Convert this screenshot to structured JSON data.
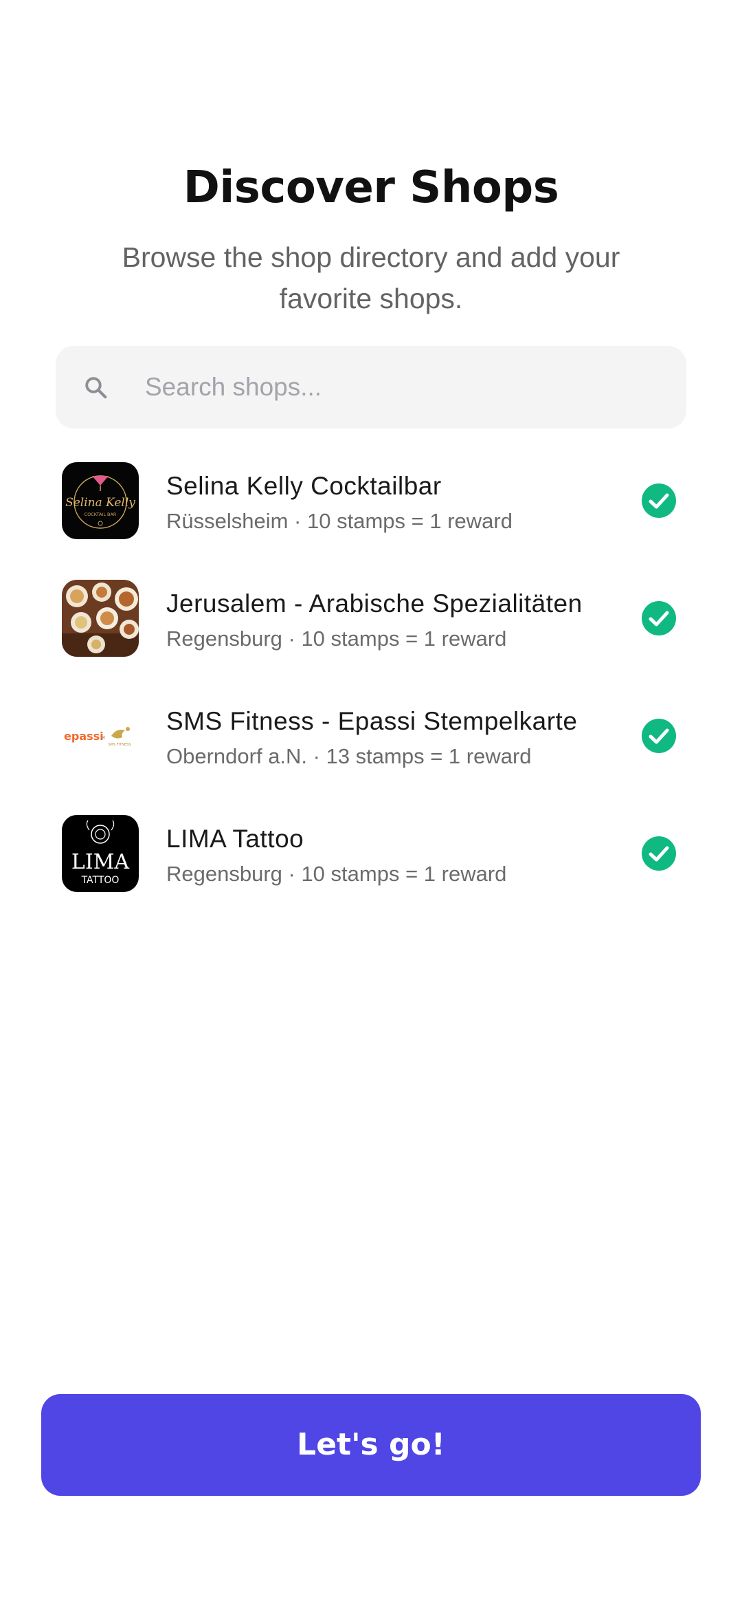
{
  "header": {
    "title": "Discover Shops",
    "subtitle": "Browse the shop directory and add your favorite shops."
  },
  "search": {
    "placeholder": "Search shops...",
    "value": "",
    "icon": "search-icon"
  },
  "shops": [
    {
      "name": "Selina Kelly Cocktailbar",
      "meta": "Rüsselsheim · 10 stamps = 1 reward",
      "logo_text": "Selina Kelly",
      "logo_subtext": "COCKTAIL BAR",
      "added": true
    },
    {
      "name": "Jerusalem - Arabische Spezialitäten",
      "meta": "Regensburg · 10 stamps = 1 reward",
      "added": true
    },
    {
      "name": "SMS Fitness - Epassi Stempelkarte",
      "meta": "Oberndorf a.N. · 13 stamps = 1 reward",
      "logo_text": "epassi",
      "logo_subtext": "SMS FITNESS",
      "added": true
    },
    {
      "name": "LIMA Tattoo",
      "meta": "Regensburg · 10 stamps = 1 reward",
      "logo_text": "LIMA",
      "logo_subtext": "TATTOO",
      "added": true
    }
  ],
  "cta": {
    "label": "Let's go!"
  },
  "colors": {
    "accent": "#4f46e5",
    "check": "#10b981",
    "search_bg": "#f4f4f5"
  }
}
